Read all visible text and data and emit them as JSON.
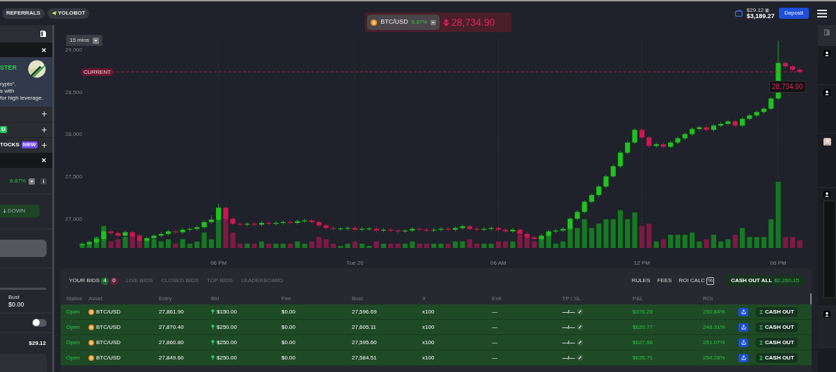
{
  "top_bar": {
    "links": [
      {
        "label": "REFERRALS",
        "kind": "plain"
      },
      {
        "label": "YOLOBOT",
        "kind": "bot"
      }
    ],
    "wallet": {
      "small": "$29.12",
      "balance": "$3,189.27"
    },
    "deposit": "Deposit"
  },
  "ticker": {
    "pair": "BTC/USD",
    "change": "6.87%",
    "price": "28,734.90",
    "falling": true
  },
  "sidebar": {
    "promo": {
      "title": "STER",
      "lines": [
        "rypto\".",
        "s with",
        "for high leverage."
      ]
    },
    "rows": [
      {
        "kind": "plus"
      },
      {
        "kind": "plus",
        "tag": "D",
        "color": "#22c55e"
      },
      {
        "kind": "plus",
        "label": "TOCKS",
        "tag": "NEW",
        "color": "#6d4aff"
      },
      {
        "kind": "close"
      }
    ],
    "trade": {
      "change": "6.87%",
      "down_button": "DOWN",
      "bust_label": "Bust",
      "bust_value": "$0.00",
      "toggle_on": false,
      "balance": "$29.12"
    }
  },
  "chart": {
    "interval": "15 mins",
    "price_label": "28,734.90",
    "chart_data": {
      "type": "candlestick",
      "grid": true,
      "ylim": [
        26654,
        29123
      ],
      "ref_lines": [
        {
          "axis": "y",
          "value": 28735,
          "label": "CURRENT"
        }
      ],
      "yticks": [
        {
          "value": 27000,
          "label": "27,000"
        },
        {
          "value": 27500,
          "label": "27,500"
        },
        {
          "value": 28000,
          "label": "28,000"
        },
        {
          "value": 28500,
          "label": "28,500"
        },
        {
          "value": 29000,
          "label": "29,000"
        }
      ],
      "categories": [
        null,
        null,
        null,
        null,
        null,
        null,
        null,
        null,
        null,
        null,
        null,
        null,
        null,
        null,
        null,
        null,
        null,
        null,
        null,
        "06 PM",
        null,
        null,
        null,
        null,
        null,
        null,
        null,
        null,
        null,
        null,
        null,
        null,
        null,
        null,
        null,
        null,
        null,
        null,
        "Tue 20",
        null,
        null,
        null,
        null,
        null,
        null,
        null,
        null,
        null,
        null,
        null,
        null,
        null,
        null,
        null,
        null,
        null,
        null,
        null,
        "06 AM",
        null,
        null,
        null,
        null,
        null,
        null,
        null,
        null,
        null,
        null,
        null,
        null,
        null,
        null,
        null,
        null,
        null,
        null,
        null,
        "12 PM",
        null,
        null,
        null,
        null,
        null,
        null,
        null,
        null,
        null,
        null,
        null,
        null,
        null,
        null,
        null,
        null,
        null,
        null,
        "06 PM",
        null,
        null,
        null
      ],
      "ohlc": [
        [
          26690,
          26720,
          26670,
          26700
        ],
        [
          26700,
          26740,
          26680,
          26720
        ],
        [
          26720,
          26780,
          26700,
          26760
        ],
        [
          26760,
          26870,
          26740,
          26850
        ],
        [
          26850,
          26870,
          26810,
          26830
        ],
        [
          26830,
          26850,
          26780,
          26800
        ],
        [
          26800,
          26860,
          26780,
          26840
        ],
        [
          26840,
          26860,
          26770,
          26790
        ],
        [
          26790,
          26810,
          26720,
          26740
        ],
        [
          26740,
          26790,
          26720,
          26770
        ],
        [
          26770,
          26820,
          26750,
          26800
        ],
        [
          26800,
          26840,
          26780,
          26820
        ],
        [
          26820,
          26870,
          26800,
          26850
        ],
        [
          26850,
          26870,
          26820,
          26840
        ],
        [
          26840,
          26890,
          26820,
          26870
        ],
        [
          26870,
          26900,
          26850,
          26880
        ],
        [
          26880,
          26920,
          26860,
          26900
        ],
        [
          26900,
          26980,
          26880,
          26960
        ],
        [
          26960,
          27040,
          26940,
          26990
        ],
        [
          26990,
          27180,
          26970,
          27130
        ],
        [
          27130,
          27150,
          26980,
          27000
        ],
        [
          27000,
          27020,
          26920,
          26940
        ],
        [
          26940,
          26960,
          26910,
          26930
        ],
        [
          26930,
          26960,
          26910,
          26940
        ],
        [
          26940,
          26960,
          26910,
          26930
        ],
        [
          26930,
          26970,
          26910,
          26950
        ],
        [
          26950,
          26970,
          26920,
          26940
        ],
        [
          26940,
          26970,
          26920,
          26950
        ],
        [
          26950,
          26980,
          26930,
          26960
        ],
        [
          26960,
          26980,
          26930,
          26950
        ],
        [
          26950,
          26990,
          26930,
          26970
        ],
        [
          26970,
          27000,
          26950,
          26980
        ],
        [
          26980,
          27000,
          26940,
          26960
        ],
        [
          26960,
          26980,
          26900,
          26920
        ],
        [
          26920,
          26940,
          26870,
          26890
        ],
        [
          26890,
          26910,
          26860,
          26880
        ],
        [
          26880,
          26900,
          26860,
          26880
        ],
        [
          26880,
          26910,
          26860,
          26890
        ],
        [
          26890,
          26910,
          26850,
          26870
        ],
        [
          26870,
          26900,
          26850,
          26880
        ],
        [
          26880,
          26900,
          26860,
          26880
        ],
        [
          26880,
          26900,
          26840,
          26860
        ],
        [
          26860,
          26890,
          26840,
          26870
        ],
        [
          26870,
          26890,
          26840,
          26860
        ],
        [
          26860,
          26880,
          26830,
          26850
        ],
        [
          26850,
          26880,
          26830,
          26860
        ],
        [
          26860,
          26900,
          26840,
          26880
        ],
        [
          26880,
          26900,
          26850,
          26870
        ],
        [
          26870,
          26890,
          26840,
          26860
        ],
        [
          26860,
          26890,
          26840,
          26870
        ],
        [
          26870,
          26900,
          26850,
          26880
        ],
        [
          26880,
          26900,
          26850,
          26870
        ],
        [
          26870,
          26910,
          26850,
          26890
        ],
        [
          26890,
          26930,
          26870,
          26910
        ],
        [
          26910,
          26930,
          26860,
          26880
        ],
        [
          26880,
          26900,
          26850,
          26870
        ],
        [
          26870,
          26900,
          26850,
          26880
        ],
        [
          26880,
          26910,
          26860,
          26890
        ],
        [
          26890,
          26910,
          26850,
          26870
        ],
        [
          26870,
          26890,
          26830,
          26850
        ],
        [
          26850,
          26890,
          26830,
          26870
        ],
        [
          26870,
          26890,
          26800,
          26820
        ],
        [
          26820,
          26840,
          26760,
          26780
        ],
        [
          26780,
          26800,
          26740,
          26760
        ],
        [
          26760,
          26820,
          26740,
          26800
        ],
        [
          26800,
          26870,
          26780,
          26850
        ],
        [
          26850,
          26880,
          26830,
          26860
        ],
        [
          26860,
          26900,
          26840,
          26880
        ],
        [
          26880,
          27020,
          26860,
          27000
        ],
        [
          27000,
          27100,
          26980,
          27080
        ],
        [
          27080,
          27220,
          27060,
          27200
        ],
        [
          27200,
          27300,
          27180,
          27280
        ],
        [
          27280,
          27400,
          27260,
          27380
        ],
        [
          27380,
          27520,
          27360,
          27500
        ],
        [
          27500,
          27640,
          27480,
          27620
        ],
        [
          27620,
          27800,
          27600,
          27780
        ],
        [
          27780,
          27920,
          27760,
          27900
        ],
        [
          27900,
          28070,
          27880,
          28050
        ],
        [
          28050,
          28070,
          27940,
          27960
        ],
        [
          27960,
          27980,
          27840,
          27860
        ],
        [
          27860,
          27900,
          27840,
          27880
        ],
        [
          27880,
          27900,
          27830,
          27850
        ],
        [
          27850,
          27920,
          27830,
          27900
        ],
        [
          27900,
          27970,
          27880,
          27950
        ],
        [
          27950,
          28020,
          27930,
          28000
        ],
        [
          28000,
          28080,
          27980,
          28060
        ],
        [
          28060,
          28100,
          28040,
          28080
        ],
        [
          28080,
          28100,
          28030,
          28050
        ],
        [
          28050,
          28120,
          28030,
          28100
        ],
        [
          28100,
          28140,
          28080,
          28120
        ],
        [
          28120,
          28170,
          28100,
          28150
        ],
        [
          28150,
          28170,
          28080,
          28100
        ],
        [
          28100,
          28200,
          28080,
          28180
        ],
        [
          28180,
          28240,
          28160,
          28220
        ],
        [
          28220,
          28280,
          28200,
          28260
        ],
        [
          28260,
          28320,
          28240,
          28300
        ],
        [
          28300,
          28440,
          28280,
          28420
        ],
        [
          28420,
          29100,
          28400,
          28840
        ],
        [
          28840,
          28860,
          28780,
          28800
        ],
        [
          28800,
          28820,
          28740,
          28760
        ],
        [
          28760,
          28780,
          28720,
          28735
        ]
      ]
    }
  },
  "bids_panel": {
    "tabs": [
      {
        "label": "YOUR BIDS",
        "selected": true,
        "counts": [
          {
            "value": "4",
            "color": "#1f6b32"
          },
          {
            "value": "0",
            "color": "#6b1f3c"
          }
        ]
      },
      {
        "label": "LIVE BIDS",
        "selected": false
      },
      {
        "label": "CLOSED BIDS",
        "selected": false
      },
      {
        "label": "TOP BIDS",
        "selected": false
      },
      {
        "label": "LEADERBOARD",
        "selected": false
      }
    ],
    "links": [
      "RULES",
      "FEES",
      "ROI CALC"
    ],
    "roi_symbol": "%",
    "cash_out_all": {
      "label": "CASH OUT ALL",
      "amount": "$2,260.15"
    },
    "columns": [
      "Status",
      "Asset",
      "Entry",
      "Bid",
      "Fee",
      "Bust",
      "X",
      "Exit",
      "TP / SL",
      "P&L",
      "ROI"
    ],
    "rows": [
      {
        "status": "Open",
        "asset": "BTC/USD",
        "entry": "27,861.90",
        "bid": "$150.00",
        "fee": "$0.00",
        "bust": "27,596.69",
        "x": "x100",
        "exit": "—",
        "tp_sl": "—/—",
        "pnl": "$376.26",
        "roi": "250.84%",
        "action": "CASH OUT"
      },
      {
        "status": "Open",
        "asset": "BTC/USD",
        "entry": "27,870.40",
        "bid": "$250.00",
        "fee": "$0.00",
        "bust": "27,605.11",
        "x": "x100",
        "exit": "—",
        "tp_sl": "—/—",
        "pnl": "$620.77",
        "roi": "248.31%",
        "action": "CASH OUT"
      },
      {
        "status": "Open",
        "asset": "BTC/USD",
        "entry": "27,860.80",
        "bid": "$250.00",
        "fee": "$0.00",
        "bust": "27,595.60",
        "x": "x100",
        "exit": "—",
        "tp_sl": "—/—",
        "pnl": "$627.66",
        "roi": "251.07%",
        "action": "CASH OUT"
      },
      {
        "status": "Open",
        "asset": "BTC/USD",
        "entry": "27,849.60",
        "bid": "$250.00",
        "fee": "$0.00",
        "bust": "27,584.51",
        "x": "x100",
        "exit": "—",
        "tp_sl": "—/—",
        "pnl": "$635.71",
        "roi": "254.28%",
        "action": "CASH OUT"
      }
    ]
  }
}
